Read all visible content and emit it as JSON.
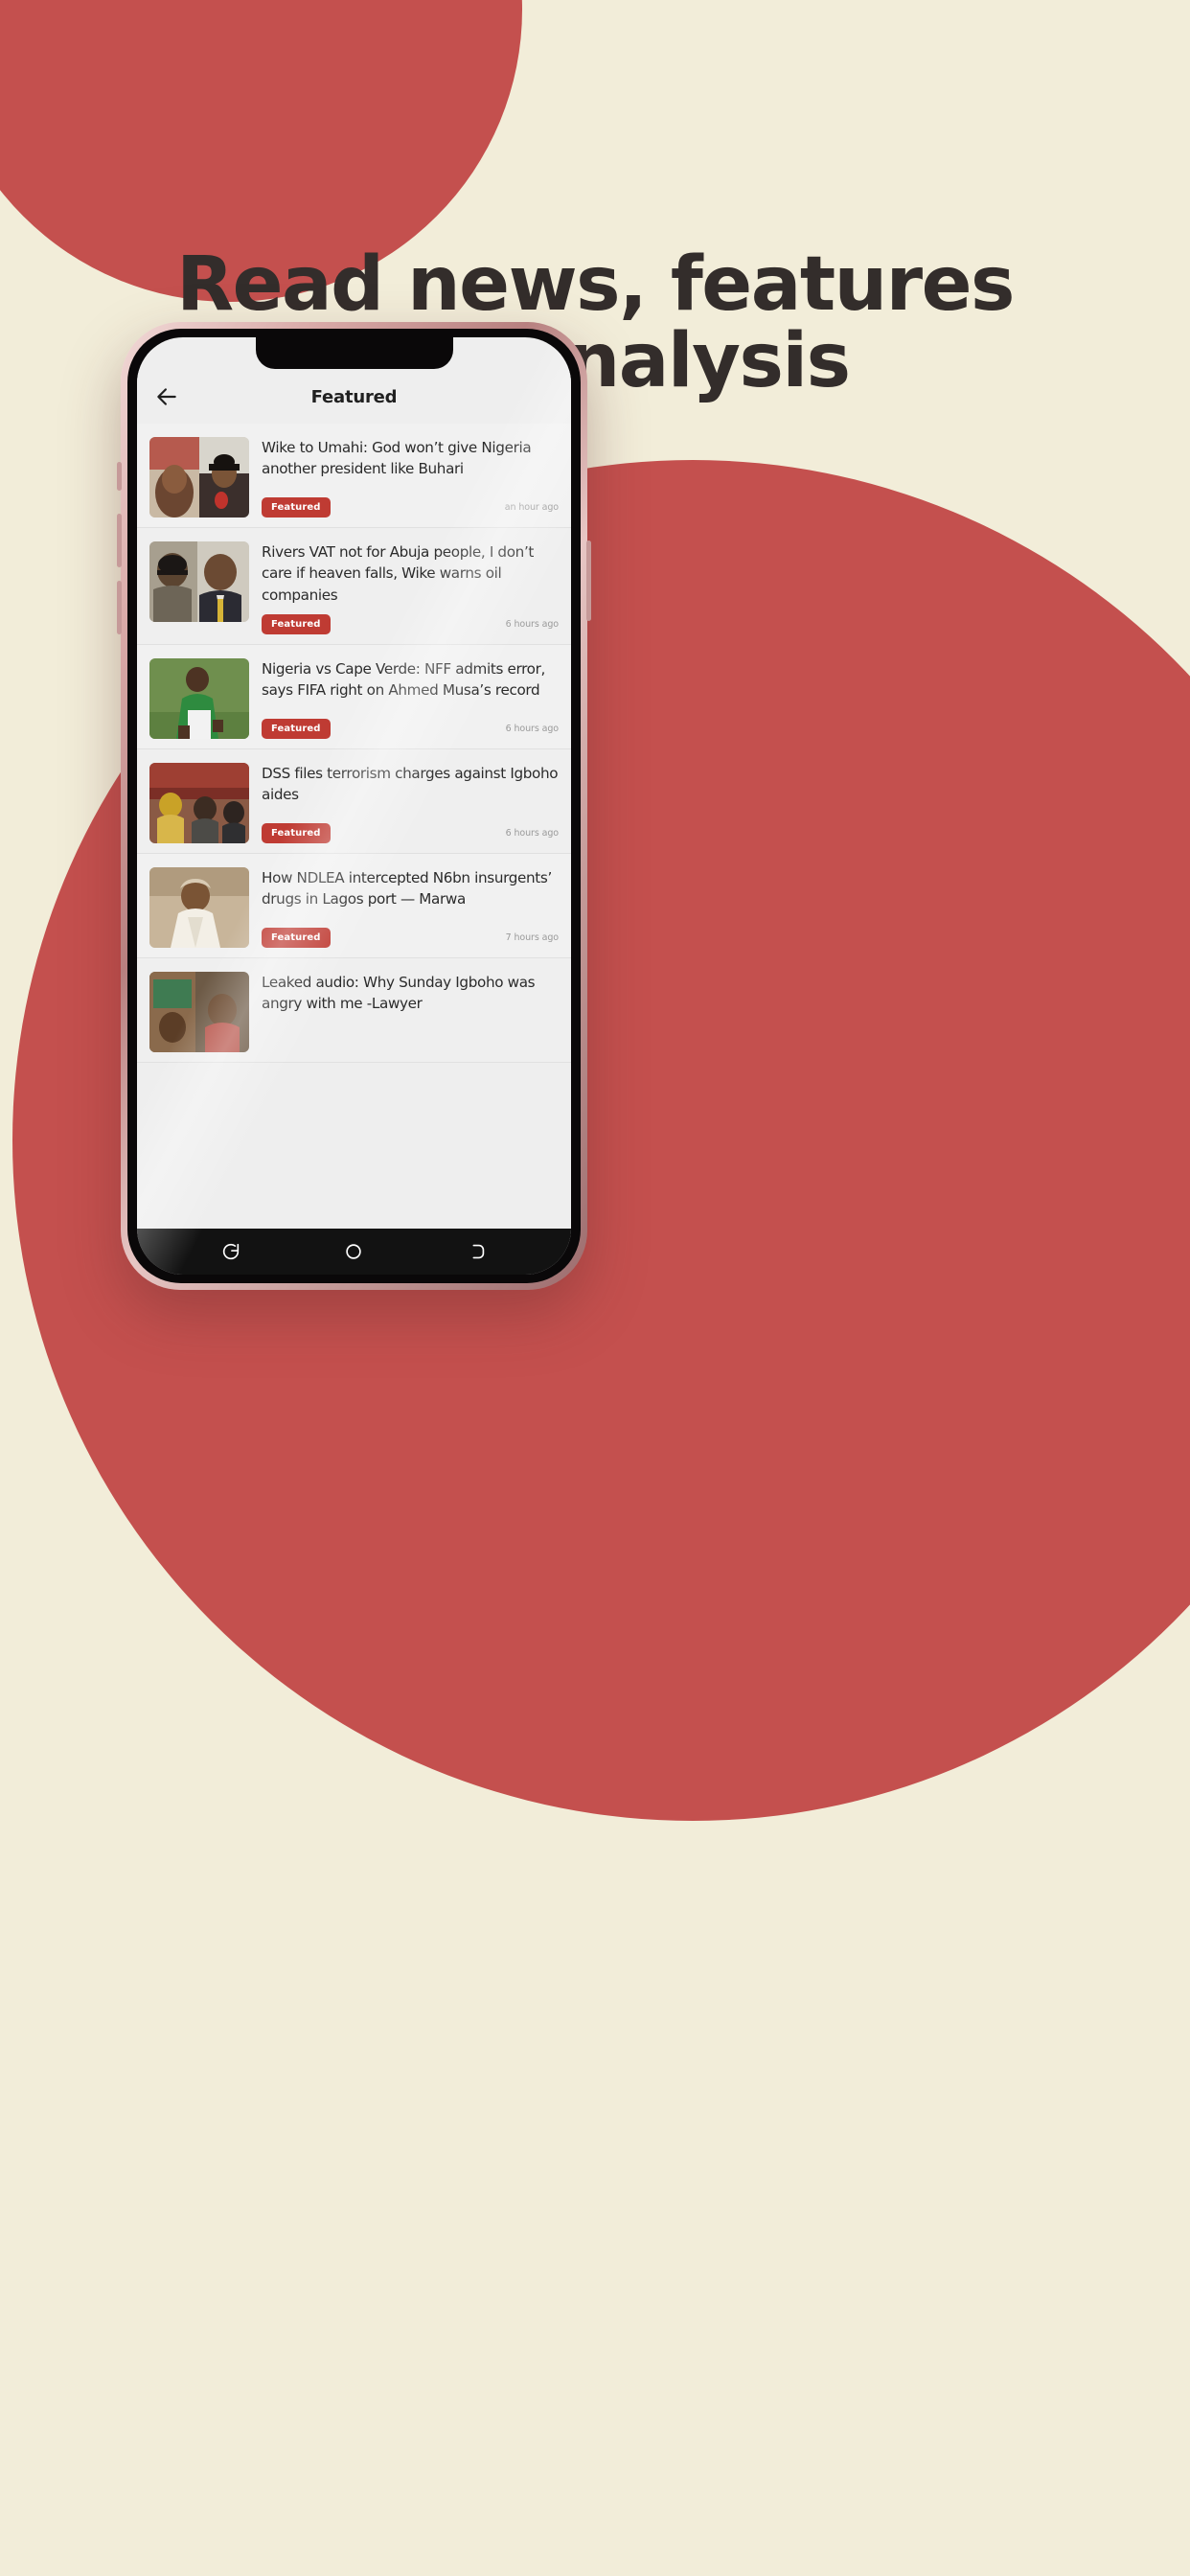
{
  "promo": {
    "headline_line1": "Read news, features",
    "headline_line2": "and analysis",
    "bg_color": "#f2edd9",
    "accent_color": "#c4504e",
    "headline_color": "#332d2b"
  },
  "app": {
    "appbar": {
      "back_icon": "arrow-left-icon",
      "title": "Featured"
    },
    "badge_color": "#bf3b33",
    "articles": [
      {
        "title": "Wike to Umahi: God won’t give Nigeria another president like Buhari",
        "badge": "Featured",
        "timestamp": "an hour ago",
        "thumb": "two-men-portrait"
      },
      {
        "title": "Rivers VAT not for Abuja people, I don’t care if heaven falls, Wike warns oil companies",
        "badge": "Featured",
        "timestamp": "6 hours ago",
        "thumb": "two-politicians"
      },
      {
        "title": "Nigeria vs Cape Verde: NFF admits error, says FIFA right on Ahmed Musa’s record",
        "badge": "Featured",
        "timestamp": "6 hours ago",
        "thumb": "footballer-green-jersey"
      },
      {
        "title": "DSS files terrorism charges against Igboho aides",
        "badge": "Featured",
        "timestamp": "6 hours ago",
        "thumb": "courtroom-seated-people"
      },
      {
        "title": "How NDLEA intercepted N6bn insurgents’ drugs in Lagos port — Marwa",
        "badge": "Featured",
        "timestamp": "7 hours ago",
        "thumb": "man-in-white-cap"
      },
      {
        "title": "Leaked audio: Why Sunday Igboho was angry with me -Lawyer",
        "badge": "",
        "timestamp": "",
        "thumb": "two-people-indoor"
      }
    ],
    "navbar": {
      "back": "android-back-icon",
      "home": "android-home-icon",
      "recents": "android-recents-icon"
    }
  }
}
